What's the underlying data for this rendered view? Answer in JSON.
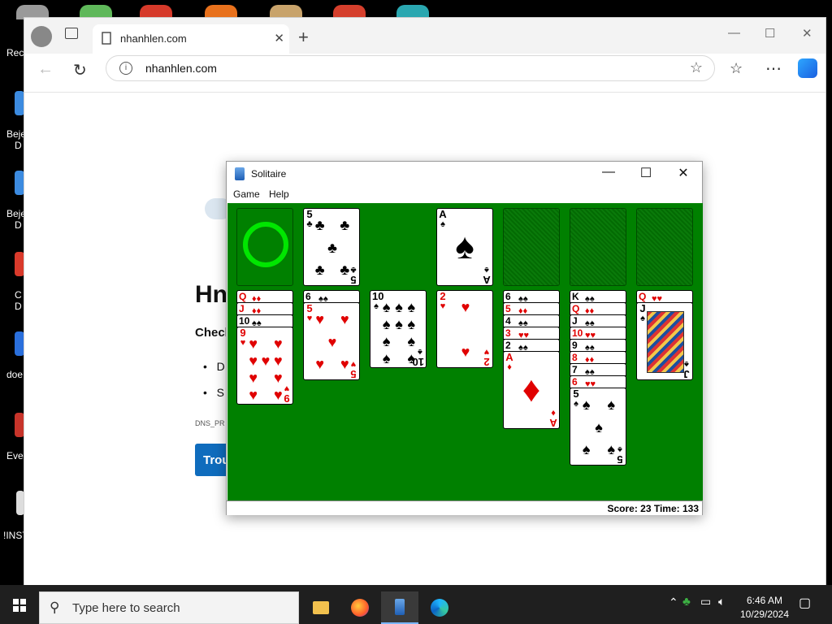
{
  "desktop": {
    "icons": [
      {
        "label": "Rec",
        "color": "#8a8a8a"
      },
      {
        "label": "Beje",
        "label2": "D",
        "color": "#3c8be0"
      },
      {
        "label": "Beje",
        "label2": "D",
        "color": "#3c8be0"
      },
      {
        "label": "C",
        "label2": "D",
        "color": "#d93a2b"
      },
      {
        "label": "doe",
        "color": "#2a6fdc"
      },
      {
        "label": "Eve",
        "color": "#c7342a"
      },
      {
        "label": "!INST",
        "color": "#dddddd"
      }
    ]
  },
  "browser": {
    "tab_title": "nhanhlen.com",
    "url": "nhanhlen.com",
    "page": {
      "heading_fragment": "Hn",
      "subheading_fragment": "Check",
      "bullets": [
        "D",
        "S"
      ],
      "error_fragment": "DNS_PR",
      "button_fragment": "Trou"
    }
  },
  "solitaire": {
    "title": "Solitaire",
    "menu": [
      "Game",
      "Help"
    ],
    "status": "Score: 23 Time: 133",
    "felt_color": "#008000",
    "top_row": [
      {
        "type": "stock_empty"
      },
      {
        "type": "card",
        "rank": "5",
        "suit": "♣",
        "color": "black"
      },
      {
        "type": "none"
      },
      {
        "type": "card",
        "rank": "A",
        "suit": "♠",
        "color": "black"
      },
      {
        "type": "slot"
      },
      {
        "type": "slot"
      },
      {
        "type": "slot"
      }
    ],
    "tableau": [
      {
        "stacked": [
          {
            "rank": "Q",
            "suit": "♦",
            "red": true
          },
          {
            "rank": "J",
            "suit": "♦",
            "red": true
          },
          {
            "rank": "10",
            "suit": "♠",
            "red": false
          }
        ],
        "top": {
          "rank": "9",
          "suit": "♥",
          "color": "red"
        }
      },
      {
        "stacked": [
          {
            "rank": "6",
            "suit": "♠",
            "red": false
          }
        ],
        "top": {
          "rank": "5",
          "suit": "♥",
          "color": "red"
        }
      },
      {
        "stacked": [],
        "top": {
          "rank": "10",
          "suit": "♠",
          "color": "black"
        }
      },
      {
        "stacked": [],
        "top": {
          "rank": "2",
          "suit": "♥",
          "color": "red"
        }
      },
      {
        "stacked": [
          {
            "rank": "6",
            "suit": "♠",
            "red": false
          },
          {
            "rank": "5",
            "suit": "♦",
            "red": true
          },
          {
            "rank": "4",
            "suit": "♠",
            "red": false
          },
          {
            "rank": "3",
            "suit": "♥",
            "red": true
          },
          {
            "rank": "2",
            "suit": "♠",
            "red": false
          }
        ],
        "top": {
          "rank": "A",
          "suit": "♦",
          "color": "red"
        }
      },
      {
        "stacked": [
          {
            "rank": "K",
            "suit": "♠",
            "red": false
          },
          {
            "rank": "Q",
            "suit": "♦",
            "red": true
          },
          {
            "rank": "J",
            "suit": "♠",
            "red": false
          },
          {
            "rank": "10",
            "suit": "♥",
            "red": true
          },
          {
            "rank": "9",
            "suit": "♠",
            "red": false
          },
          {
            "rank": "8",
            "suit": "♦",
            "red": true
          },
          {
            "rank": "7",
            "suit": "♠",
            "red": false
          },
          {
            "rank": "6",
            "suit": "♥",
            "red": true
          }
        ],
        "top": {
          "rank": "5",
          "suit": "♠",
          "color": "black"
        }
      },
      {
        "stacked": [
          {
            "rank": "Q",
            "suit": "♥",
            "red": true
          }
        ],
        "top": {
          "rank": "J",
          "suit": "♠",
          "color": "black",
          "court": true
        }
      }
    ]
  },
  "taskbar": {
    "search_placeholder": "Type here to search",
    "time": "6:46 AM",
    "date": "10/29/2024"
  }
}
